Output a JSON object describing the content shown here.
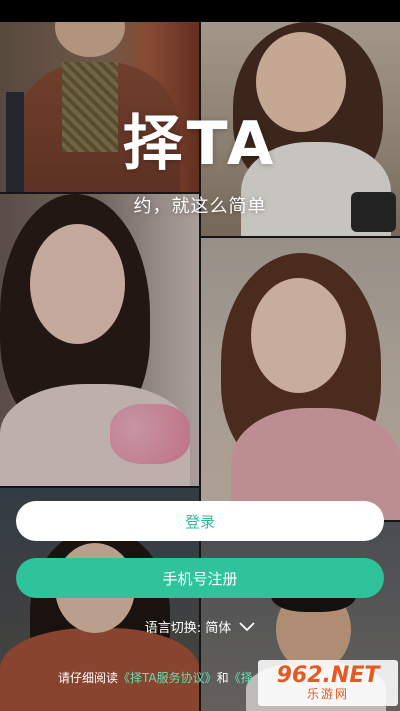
{
  "brand": {
    "logo": "择TA",
    "slogan": "约，就这么简单"
  },
  "buttons": {
    "login": "登录",
    "register": "手机号注册"
  },
  "language": {
    "label": "语言切换: 简体",
    "chevron_icon": "chevron-down-icon"
  },
  "agreement": {
    "prefix": "请仔细阅读",
    "service_link": "《择TA服务协议》",
    "joiner": "和",
    "privacy_link_partial": "《择"
  },
  "watermark": {
    "top": "962.NET",
    "bottom": "乐游网"
  },
  "colors": {
    "accent": "#2fc39b",
    "link": "#5fe0b7",
    "login_text": "#2dbf98"
  }
}
